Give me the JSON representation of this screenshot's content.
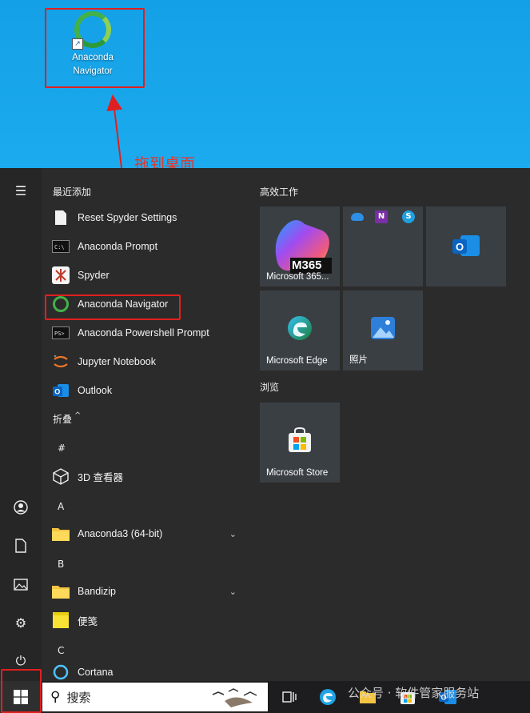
{
  "desktop": {
    "icon_label_line1": "Anaconda",
    "icon_label_line2": "Navigator"
  },
  "annotation": {
    "text": "拖到桌面"
  },
  "start_menu": {
    "recent_header": "最近添加",
    "recent": [
      {
        "label": "Reset Spyder Settings",
        "icon": "document-icon"
      },
      {
        "label": "Anaconda Prompt",
        "icon": "terminal-icon"
      },
      {
        "label": "Spyder",
        "icon": "spyder-icon"
      },
      {
        "label": "Anaconda Navigator",
        "icon": "anaconda-icon"
      },
      {
        "label": "Anaconda Powershell Prompt",
        "icon": "terminal-icon"
      },
      {
        "label": "Jupyter Notebook",
        "icon": "jupyter-icon"
      },
      {
        "label": "Outlook",
        "icon": "outlook-icon"
      }
    ],
    "collapse_label": "折叠",
    "hash_header": "#",
    "viewer_label": "3D 查看器",
    "a_header": "A",
    "anaconda3_label": "Anaconda3 (64-bit)",
    "b_header": "B",
    "bandizip_label": "Bandizip",
    "sticky_label": "便笺",
    "c_header": "C",
    "cortana_label": "Cortana"
  },
  "tiles": {
    "group1": "高效工作",
    "m365_badge": "M365",
    "m365_label": "Microsoft 365...",
    "edge_label": "Microsoft Edge",
    "photos_label": "照片",
    "group2": "浏览",
    "store_label": "Microsoft Store"
  },
  "taskbar": {
    "search_text": "搜索",
    "watermark": "公众号 · 软件管家服务站"
  },
  "colors": {
    "accent_red": "#e02020",
    "menu_bg": "#2b2b2b",
    "desktop_blue": "#1aa3e6"
  }
}
